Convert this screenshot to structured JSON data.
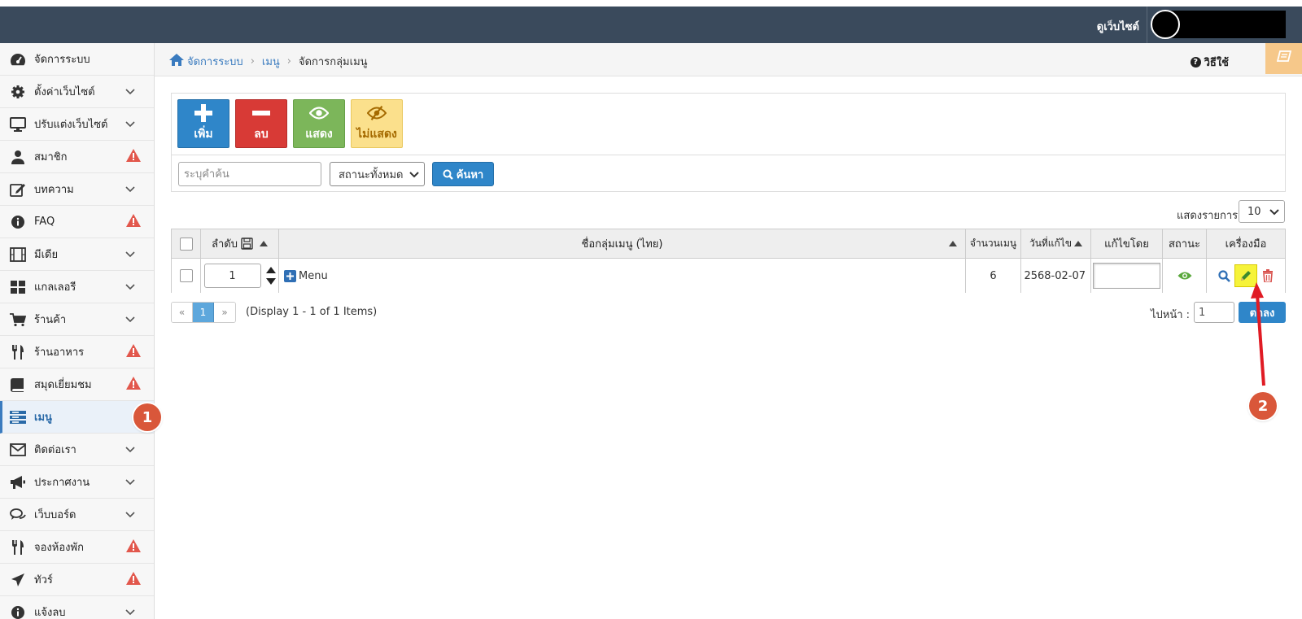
{
  "header": {
    "view_site": "ดูเว็บไซต์"
  },
  "sidebar": {
    "items": [
      {
        "label": "จัดการระบบ",
        "icon": "dashboard-icon",
        "chevron": false,
        "warning": false
      },
      {
        "label": "ตั้งค่าเว็บไซต์",
        "icon": "gear-icon",
        "chevron": true,
        "warning": false
      },
      {
        "label": "ปรับแต่งเว็บไซต์",
        "icon": "monitor-icon",
        "chevron": true,
        "warning": false
      },
      {
        "label": "สมาชิก",
        "icon": "user-icon",
        "chevron": false,
        "warning": true
      },
      {
        "label": "บทความ",
        "icon": "edit-icon",
        "chevron": true,
        "warning": false
      },
      {
        "label": "FAQ",
        "icon": "info-icon",
        "chevron": false,
        "warning": true
      },
      {
        "label": "มีเดีย",
        "icon": "film-icon",
        "chevron": true,
        "warning": false
      },
      {
        "label": "แกลเลอรี",
        "icon": "grid-icon",
        "chevron": true,
        "warning": false
      },
      {
        "label": "ร้านค้า",
        "icon": "cart-icon",
        "chevron": true,
        "warning": false
      },
      {
        "label": "ร้านอาหาร",
        "icon": "cutlery-icon",
        "chevron": false,
        "warning": true
      },
      {
        "label": "สมุดเยี่ยมชม",
        "icon": "book-icon",
        "chevron": false,
        "warning": true
      },
      {
        "label": "เมนู",
        "icon": "menu-list-icon",
        "chevron": false,
        "warning": false,
        "active": true
      },
      {
        "label": "ติดต่อเรา",
        "icon": "envelope-icon",
        "chevron": true,
        "warning": false
      },
      {
        "label": "ประกาศงาน",
        "icon": "megaphone-icon",
        "chevron": true,
        "warning": false
      },
      {
        "label": "เว็บบอร์ด",
        "icon": "comments-icon",
        "chevron": true,
        "warning": false
      },
      {
        "label": "จองห้องพัก",
        "icon": "cutlery-icon",
        "chevron": false,
        "warning": true
      },
      {
        "label": "ทัวร์",
        "icon": "plane-icon",
        "chevron": false,
        "warning": true
      },
      {
        "label": "แจ้งลบ",
        "icon": "info-icon",
        "chevron": true,
        "warning": false
      }
    ]
  },
  "breadcrumb": {
    "items": [
      "จัดการระบบ",
      "เมนู"
    ],
    "current": "จัดการกลุ่มเมนู"
  },
  "help_label": "วิธีใช้",
  "toolbar": {
    "add": "เพิ่ม",
    "delete": "ลบ",
    "show": "แสดง",
    "hide": "ไม่แสดง"
  },
  "search": {
    "placeholder": "ระบุคำค้น",
    "status_value": "สถานะทั้งหมด",
    "button": "ค้นหา"
  },
  "per_page": {
    "label": "แสดงรายการ",
    "value": "10"
  },
  "table": {
    "headers": {
      "order": "ลำดับ",
      "name": "ชื่อกลุ่มเมนู (ไทย)",
      "count": "จำนวนเมนู",
      "edited_date": "วันที่แก้ไข",
      "edited_by": "แก้ไขโดย",
      "status": "สถานะ",
      "tools": "เครื่องมือ"
    },
    "rows": [
      {
        "order": "1",
        "name": "Menu",
        "count": "6",
        "edited_date": "2568-02-07",
        "edited_by": ""
      }
    ]
  },
  "pagination": {
    "prev": "«",
    "current": "1",
    "next": "»",
    "display": "(Display 1 - 1 of 1 Items)",
    "goto_label": "ไปหน้า :",
    "goto_value": "1",
    "goto_button": "ตกลง"
  },
  "annotations": {
    "step1": "1",
    "step2": "2"
  },
  "colors": {
    "topbar": "#3a4a5c",
    "primary": "#2f86c9",
    "danger": "#d83a36",
    "success": "#7cb65a",
    "warning": "#fbe08c",
    "annotation": "#d9573a",
    "arrow": "#e01b24"
  }
}
